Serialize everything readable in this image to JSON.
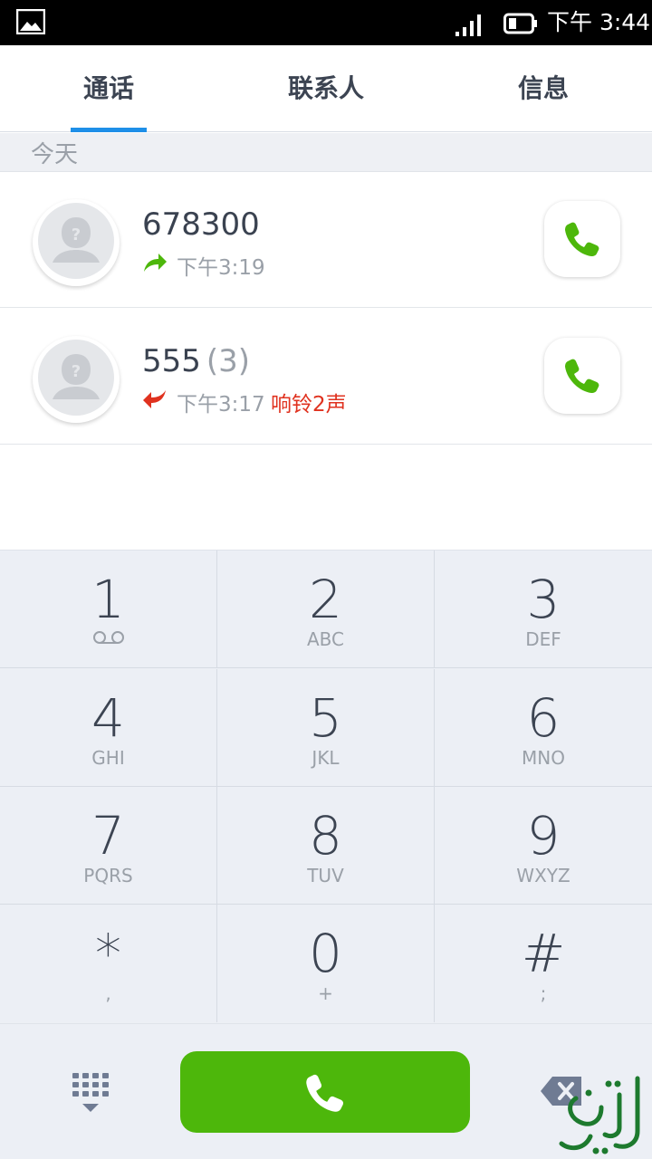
{
  "status_bar": {
    "time": "下午 3:44",
    "icons": [
      "gallery-icon",
      "signal-icon",
      "battery-icon"
    ]
  },
  "tabs": [
    {
      "label": "通话",
      "active": true
    },
    {
      "label": "联系人",
      "active": false
    },
    {
      "label": "信息",
      "active": false
    }
  ],
  "section": {
    "label": "今天"
  },
  "calls": [
    {
      "number": "678300",
      "count": "",
      "direction": "outgoing",
      "time": "下午3:19",
      "note": ""
    },
    {
      "number": "555",
      "count": "(3)",
      "direction": "missed",
      "time": "下午3:17",
      "note": "响铃2声"
    }
  ],
  "dialpad": {
    "keys": [
      {
        "digit": "1",
        "letters": ""
      },
      {
        "digit": "2",
        "letters": "ABC"
      },
      {
        "digit": "3",
        "letters": "DEF"
      },
      {
        "digit": "4",
        "letters": "GHI"
      },
      {
        "digit": "5",
        "letters": "JKL"
      },
      {
        "digit": "6",
        "letters": "MNO"
      },
      {
        "digit": "7",
        "letters": "PQRS"
      },
      {
        "digit": "8",
        "letters": "TUV"
      },
      {
        "digit": "9",
        "letters": "WXYZ"
      },
      {
        "digit": "*",
        "letters": ","
      },
      {
        "digit": "0",
        "letters": "+"
      },
      {
        "digit": "#",
        "letters": ";"
      }
    ]
  },
  "colors": {
    "accent": "#1e8fe8",
    "dial_green": "#4db70b",
    "outgoing_green": "#4db70b",
    "missed_red": "#e0321f"
  }
}
